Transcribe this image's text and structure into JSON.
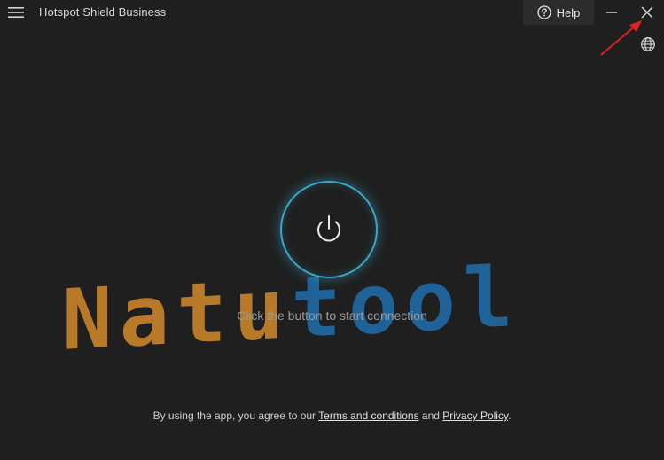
{
  "app": {
    "title": "Hotspot Shield Business"
  },
  "titlebar": {
    "menu_icon": "hamburger-menu-icon",
    "help_icon": "question-circle-icon",
    "help_label": "Help",
    "minimize_icon": "minimize-icon",
    "close_icon": "close-icon",
    "language_icon": "globe-icon"
  },
  "main": {
    "connect_icon": "power-icon",
    "status": "Click the button to start connection",
    "accent_color": "#3aa6c8"
  },
  "footer": {
    "prefix": "By using the app, you agree to our ",
    "terms_link": "Terms and conditions",
    "middle": " and ",
    "privacy_link": "Privacy Policy",
    "suffix": "."
  },
  "watermark": {
    "part1": "Natu",
    "part2": "tool",
    "color1": "#c9842a",
    "color2": "#1e6aa6"
  },
  "annotation": {
    "arrow_color": "#e0201f"
  }
}
